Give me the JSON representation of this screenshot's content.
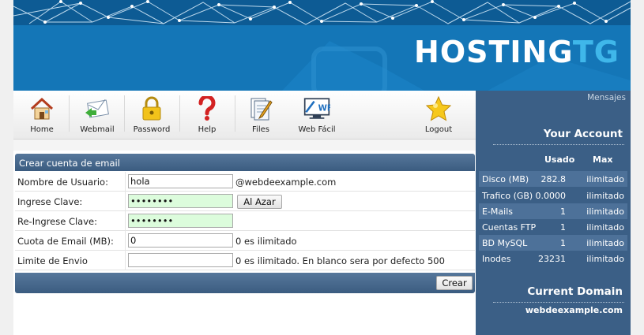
{
  "brand": {
    "logo_main": "HOSTING",
    "logo_accent": "TG"
  },
  "toolbar": {
    "items": [
      {
        "key": "home",
        "label": "Home",
        "icon": "house-icon"
      },
      {
        "key": "webmail",
        "label": "Webmail",
        "icon": "envelope-icon"
      },
      {
        "key": "password",
        "label": "Password",
        "icon": "padlock-icon"
      },
      {
        "key": "help",
        "label": "Help",
        "icon": "question-mark-icon"
      },
      {
        "key": "files",
        "label": "Files",
        "icon": "document-pen-icon"
      },
      {
        "key": "webfacil",
        "label": "Web Fácil",
        "icon": "web-facil-icon"
      },
      {
        "key": "logout",
        "label": "Logout",
        "icon": "star-icon"
      }
    ]
  },
  "form": {
    "title": "Crear cuenta de email",
    "username_label": "Nombre de Usuario:",
    "username_value": "hola",
    "domain_suffix": "@webdeexample.com",
    "password_label": "Ingrese Clave:",
    "password_value": "abcdefgh",
    "random_button": "Al Azar",
    "repassword_label": "Re-Ingrese Clave:",
    "repassword_value": "abcdefgh",
    "quota_label": "Cuota de Email (MB):",
    "quota_value": "0",
    "quota_hint": "0 es ilimitado",
    "limit_label": "Limite de Envio",
    "limit_value": "",
    "limit_hint": "0 es ilimitado. En blanco sera por defecto 500",
    "submit_label": "Crear"
  },
  "sidebar": {
    "messages_link": "Mensajes",
    "account_title": "Your Account",
    "col_used": "Usado",
    "col_max": "Max",
    "rows": [
      {
        "name": "Disco (MB)",
        "used": "282.8",
        "max": "ilimitado"
      },
      {
        "name": "Trafico (GB)",
        "used": "0.0000",
        "max": "ilimitado"
      },
      {
        "name": "E-Mails",
        "used": "1",
        "max": "ilimitado"
      },
      {
        "name": "Cuentas FTP",
        "used": "1",
        "max": "ilimitado"
      },
      {
        "name": "BD MySQL",
        "used": "1",
        "max": "ilimitado"
      },
      {
        "name": "Inodes",
        "used": "23231",
        "max": "ilimitado"
      }
    ],
    "domain_title": "Current Domain",
    "domain_value": "webdeexample.com"
  },
  "colors": {
    "header": "#1476b7",
    "sidebar": "#3b5f86",
    "bar": "#4a6b90",
    "password_bg": "#dcfcdc"
  }
}
